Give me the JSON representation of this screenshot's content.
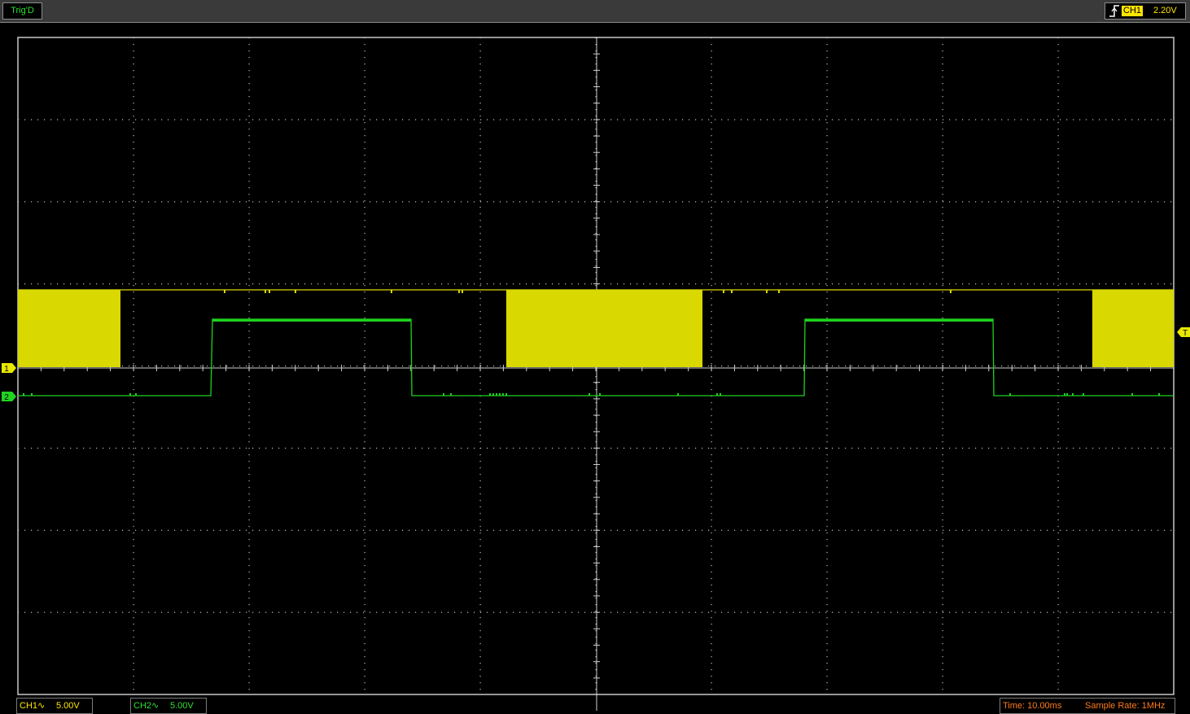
{
  "header": {
    "trigger_status": "Trig'D",
    "trigger_source": "CH1",
    "trigger_level": "2.20V",
    "trigger_edge_icon": "rising-edge-icon"
  },
  "markers": {
    "ch1_ground": "1",
    "ch2_ground": "2",
    "trigger_level": "T"
  },
  "footer": {
    "ch1": {
      "name": "CH1",
      "coupling_icon": "ac-coupling-icon",
      "coupling_glyph": "∿",
      "volts_div": "5.00V"
    },
    "ch2": {
      "name": "CH2",
      "coupling_icon": "ac-coupling-icon",
      "coupling_glyph": "∿",
      "volts_div": "5.00V"
    },
    "time": "Time: 10.00ms",
    "sample_rate": "Sample Rate: 1MHz"
  },
  "colors": {
    "ch1": "#d9d800",
    "ch2": "#1fd11f",
    "grid": "#bfbfbf",
    "time_text": "#ff7a1a"
  }
}
